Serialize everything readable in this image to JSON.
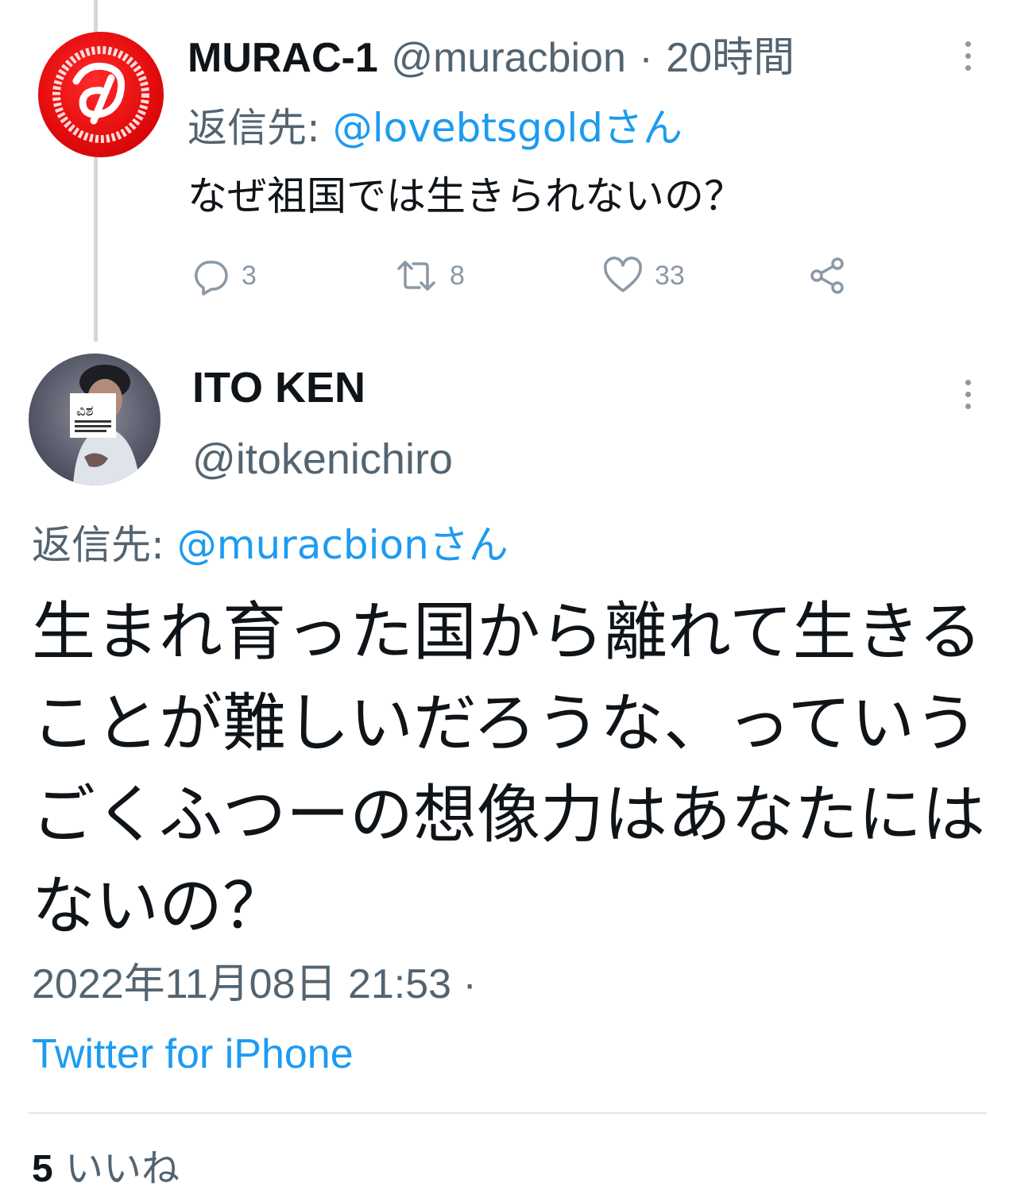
{
  "tweet1": {
    "display_name": "MURAC-1",
    "handle": "@muracbion",
    "separator": "·",
    "time": "20時間",
    "reply_prefix": "返信先:",
    "reply_to": "@lovebtsgoldさん",
    "text": "なぜ祖国では生きられないの？",
    "actions": {
      "replies": "3",
      "retweets": "8",
      "likes": "33"
    }
  },
  "tweet2": {
    "display_name": "ITO KEN",
    "handle": "@itokenichiro",
    "reply_prefix": "返信先:",
    "reply_to": "@muracbionさん",
    "text": "生まれ育った国から離れて生きることが難しいだろうな、っていうごくふつーの想像力はあなたにはないの？",
    "timestamp": "2022年11月08日 21:53 ·",
    "source": "Twitter for iPhone",
    "like_count": "5",
    "like_label": "いいね"
  },
  "colors": {
    "link": "#1d9bf0",
    "secondary": "#536471",
    "avatar_red": "#e50d0d"
  },
  "icons": [
    "reply-icon",
    "retweet-icon",
    "like-icon",
    "share-icon",
    "more-icon"
  ]
}
